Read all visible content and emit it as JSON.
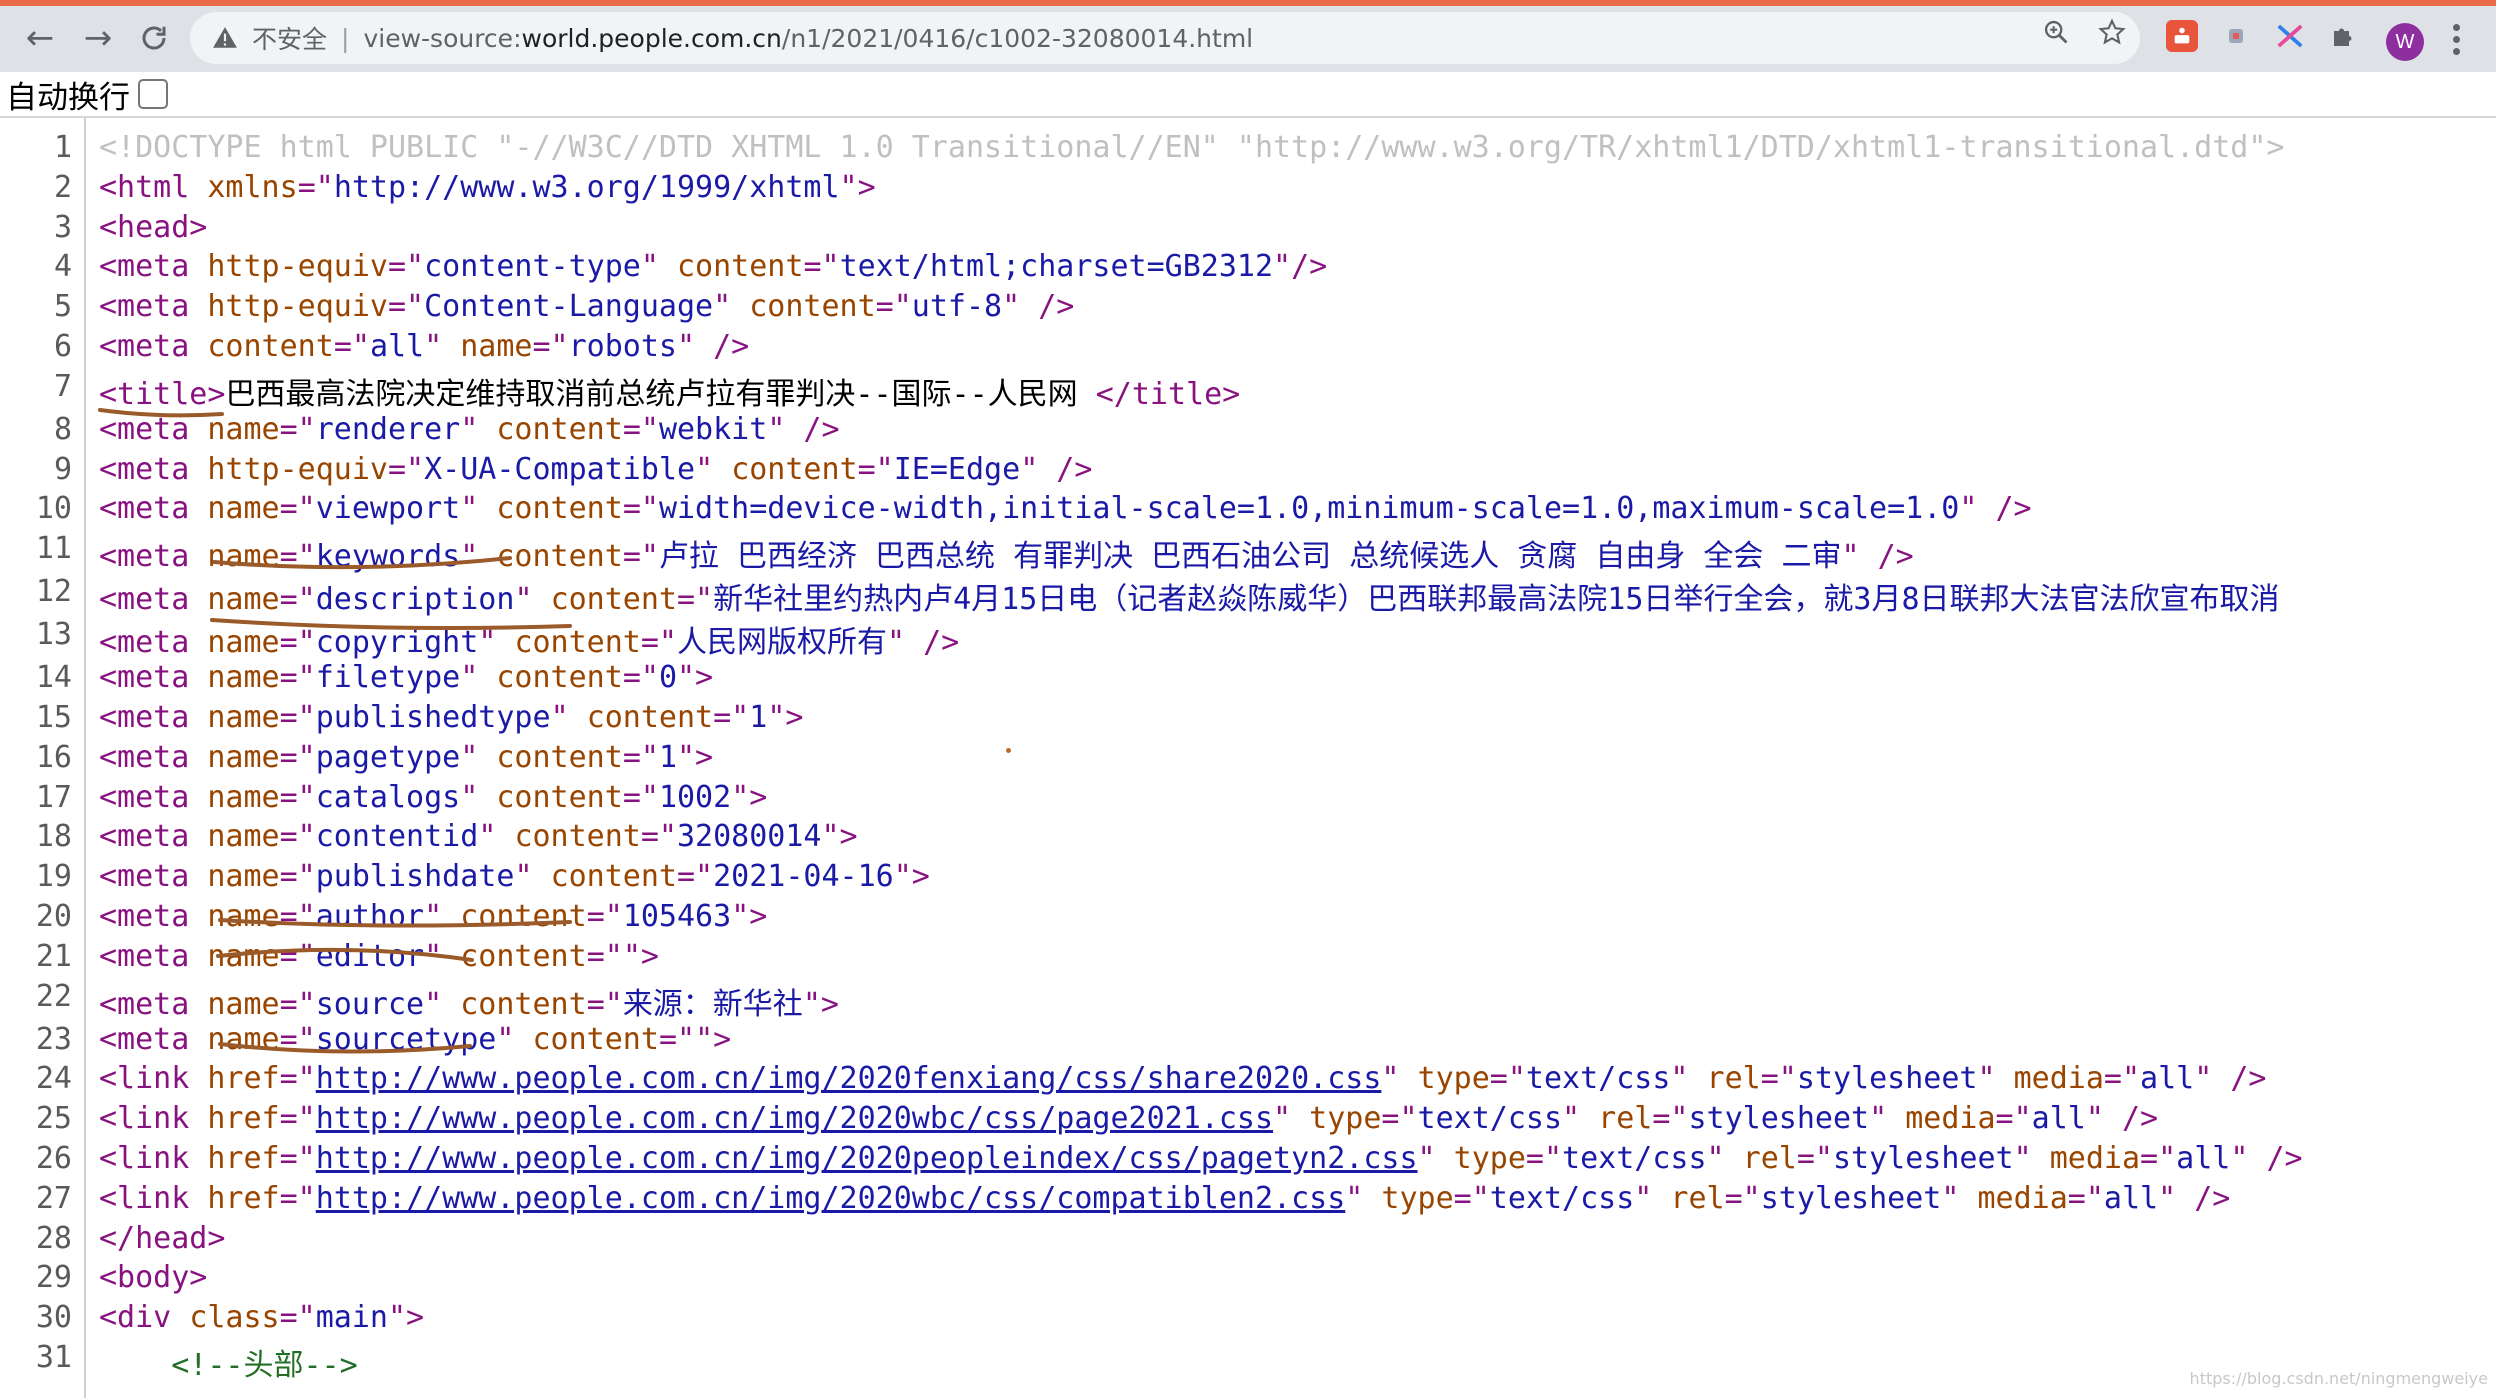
{
  "browser": {
    "security_label": "不安全",
    "url_prefix": "view-source:",
    "url_host": "world.people.com.cn",
    "url_path": "/n1/2021/0416/c1002-32080014.html",
    "avatar_letter": "W",
    "icons": [
      "back-icon",
      "forward-icon",
      "reload-icon",
      "warning-icon",
      "zoom-icon",
      "star-icon",
      "extension-icon",
      "puzzle-icon",
      "menu-icon"
    ]
  },
  "wrap_toggle": {
    "label": "自动换行",
    "checked": false
  },
  "source": {
    "lines": [
      {
        "n": "1",
        "tokens": [
          [
            "doc",
            "<!DOCTYPE html PUBLIC \"-//W3C//DTD XHTML 1.0 Transitional//EN\" \"http://www.w3.org/TR/xhtml1/DTD/xhtml1-transitional.dtd\">"
          ]
        ]
      },
      {
        "n": "2",
        "tokens": [
          [
            "tag",
            "<html "
          ],
          [
            "attr",
            "xmlns"
          ],
          [
            "tag",
            "=\""
          ],
          [
            "val",
            "http://www.w3.org/1999/xhtml"
          ],
          [
            "tag",
            "\">"
          ]
        ]
      },
      {
        "n": "3",
        "tokens": [
          [
            "tag",
            "<head>"
          ]
        ]
      },
      {
        "n": "4",
        "tokens": [
          [
            "tag",
            "<meta "
          ],
          [
            "attr",
            "http-equiv"
          ],
          [
            "tag",
            "=\""
          ],
          [
            "val",
            "content-type"
          ],
          [
            "tag",
            "\" "
          ],
          [
            "attr",
            "content"
          ],
          [
            "tag",
            "=\""
          ],
          [
            "val",
            "text/html;charset=GB2312"
          ],
          [
            "tag",
            "\"/>"
          ]
        ]
      },
      {
        "n": "5",
        "tokens": [
          [
            "tag",
            "<meta "
          ],
          [
            "attr",
            "http-equiv"
          ],
          [
            "tag",
            "=\""
          ],
          [
            "val",
            "Content-Language"
          ],
          [
            "tag",
            "\" "
          ],
          [
            "attr",
            "content"
          ],
          [
            "tag",
            "=\""
          ],
          [
            "val",
            "utf-8"
          ],
          [
            "tag",
            "\" />"
          ]
        ]
      },
      {
        "n": "6",
        "tokens": [
          [
            "tag",
            "<meta "
          ],
          [
            "attr",
            "content"
          ],
          [
            "tag",
            "=\""
          ],
          [
            "val",
            "all"
          ],
          [
            "tag",
            "\" "
          ],
          [
            "attr",
            "name"
          ],
          [
            "tag",
            "=\""
          ],
          [
            "val",
            "robots"
          ],
          [
            "tag",
            "\" />"
          ]
        ]
      },
      {
        "n": "7",
        "tokens": [
          [
            "tag",
            "<title>"
          ],
          [
            "text",
            "巴西最高法院决定维持取消前总统卢拉有罪判决--国际--人民网 "
          ],
          [
            "tag",
            "</title>"
          ]
        ]
      },
      {
        "n": "8",
        "tokens": [
          [
            "tag",
            "<meta "
          ],
          [
            "attr",
            "name"
          ],
          [
            "tag",
            "=\""
          ],
          [
            "val",
            "renderer"
          ],
          [
            "tag",
            "\" "
          ],
          [
            "attr",
            "content"
          ],
          [
            "tag",
            "=\""
          ],
          [
            "val",
            "webkit"
          ],
          [
            "tag",
            "\" />"
          ]
        ]
      },
      {
        "n": "9",
        "tokens": [
          [
            "tag",
            "<meta "
          ],
          [
            "attr",
            "http-equiv"
          ],
          [
            "tag",
            "=\""
          ],
          [
            "val",
            "X-UA-Compatible"
          ],
          [
            "tag",
            "\" "
          ],
          [
            "attr",
            "content"
          ],
          [
            "tag",
            "=\""
          ],
          [
            "val",
            "IE=Edge"
          ],
          [
            "tag",
            "\" />"
          ]
        ]
      },
      {
        "n": "10",
        "tokens": [
          [
            "tag",
            "<meta "
          ],
          [
            "attr",
            "name"
          ],
          [
            "tag",
            "=\""
          ],
          [
            "val",
            "viewport"
          ],
          [
            "tag",
            "\" "
          ],
          [
            "attr",
            "content"
          ],
          [
            "tag",
            "=\""
          ],
          [
            "val",
            "width=device-width,initial-scale=1.0,minimum-scale=1.0,maximum-scale=1.0"
          ],
          [
            "tag",
            "\" />"
          ]
        ]
      },
      {
        "n": "11",
        "tokens": [
          [
            "tag",
            "<meta "
          ],
          [
            "attr",
            "name"
          ],
          [
            "tag",
            "=\""
          ],
          [
            "val",
            "keywords"
          ],
          [
            "tag",
            "\" "
          ],
          [
            "attr",
            "content"
          ],
          [
            "tag",
            "=\""
          ],
          [
            "val",
            "卢拉 巴西经济 巴西总统 有罪判决 巴西石油公司 总统候选人 贪腐 自由身 全会 二审"
          ],
          [
            "tag",
            "\" />"
          ]
        ]
      },
      {
        "n": "12",
        "tokens": [
          [
            "tag",
            "<meta "
          ],
          [
            "attr",
            "name"
          ],
          [
            "tag",
            "=\""
          ],
          [
            "val",
            "description"
          ],
          [
            "tag",
            "\" "
          ],
          [
            "attr",
            "content"
          ],
          [
            "tag",
            "=\""
          ],
          [
            "val",
            "新华社里约热内卢4月15日电（记者赵焱陈威华）巴西联邦最高法院15日举行全会，就3月8日联邦大法官法欣宣布取消"
          ]
        ]
      },
      {
        "n": "13",
        "tokens": [
          [
            "tag",
            "<meta "
          ],
          [
            "attr",
            "name"
          ],
          [
            "tag",
            "=\""
          ],
          [
            "val",
            "copyright"
          ],
          [
            "tag",
            "\" "
          ],
          [
            "attr",
            "content"
          ],
          [
            "tag",
            "=\""
          ],
          [
            "val",
            "人民网版权所有"
          ],
          [
            "tag",
            "\" />"
          ]
        ]
      },
      {
        "n": "14",
        "tokens": [
          [
            "tag",
            "<meta "
          ],
          [
            "attr",
            "name"
          ],
          [
            "tag",
            "=\""
          ],
          [
            "val",
            "filetype"
          ],
          [
            "tag",
            "\" "
          ],
          [
            "attr",
            "content"
          ],
          [
            "tag",
            "=\""
          ],
          [
            "val",
            "0"
          ],
          [
            "tag",
            "\">"
          ]
        ]
      },
      {
        "n": "15",
        "tokens": [
          [
            "tag",
            "<meta "
          ],
          [
            "attr",
            "name"
          ],
          [
            "tag",
            "=\""
          ],
          [
            "val",
            "publishedtype"
          ],
          [
            "tag",
            "\" "
          ],
          [
            "attr",
            "content"
          ],
          [
            "tag",
            "=\""
          ],
          [
            "val",
            "1"
          ],
          [
            "tag",
            "\">"
          ]
        ]
      },
      {
        "n": "16",
        "tokens": [
          [
            "tag",
            "<meta "
          ],
          [
            "attr",
            "name"
          ],
          [
            "tag",
            "=\""
          ],
          [
            "val",
            "pagetype"
          ],
          [
            "tag",
            "\" "
          ],
          [
            "attr",
            "content"
          ],
          [
            "tag",
            "=\""
          ],
          [
            "val",
            "1"
          ],
          [
            "tag",
            "\">"
          ]
        ]
      },
      {
        "n": "17",
        "tokens": [
          [
            "tag",
            "<meta "
          ],
          [
            "attr",
            "name"
          ],
          [
            "tag",
            "=\""
          ],
          [
            "val",
            "catalogs"
          ],
          [
            "tag",
            "\" "
          ],
          [
            "attr",
            "content"
          ],
          [
            "tag",
            "=\""
          ],
          [
            "val",
            "1002"
          ],
          [
            "tag",
            "\">"
          ]
        ]
      },
      {
        "n": "18",
        "tokens": [
          [
            "tag",
            "<meta "
          ],
          [
            "attr",
            "name"
          ],
          [
            "tag",
            "=\""
          ],
          [
            "val",
            "contentid"
          ],
          [
            "tag",
            "\" "
          ],
          [
            "attr",
            "content"
          ],
          [
            "tag",
            "=\""
          ],
          [
            "val",
            "32080014"
          ],
          [
            "tag",
            "\">"
          ]
        ]
      },
      {
        "n": "19",
        "tokens": [
          [
            "tag",
            "<meta "
          ],
          [
            "attr",
            "name"
          ],
          [
            "tag",
            "=\""
          ],
          [
            "val",
            "publishdate"
          ],
          [
            "tag",
            "\" "
          ],
          [
            "attr",
            "content"
          ],
          [
            "tag",
            "=\""
          ],
          [
            "val",
            "2021-04-16"
          ],
          [
            "tag",
            "\">"
          ]
        ]
      },
      {
        "n": "20",
        "tokens": [
          [
            "tag",
            "<meta "
          ],
          [
            "attr",
            "name"
          ],
          [
            "tag",
            "=\""
          ],
          [
            "val",
            "author"
          ],
          [
            "tag",
            "\" "
          ],
          [
            "attr",
            "content"
          ],
          [
            "tag",
            "=\""
          ],
          [
            "val",
            "105463"
          ],
          [
            "tag",
            "\">"
          ]
        ]
      },
      {
        "n": "21",
        "tokens": [
          [
            "tag",
            "<meta "
          ],
          [
            "attr",
            "name"
          ],
          [
            "tag",
            "=\""
          ],
          [
            "val",
            "editor"
          ],
          [
            "tag",
            "\" "
          ],
          [
            "attr",
            "content"
          ],
          [
            "tag",
            "=\""
          ],
          [
            "val",
            ""
          ],
          [
            "tag",
            "\">"
          ]
        ]
      },
      {
        "n": "22",
        "tokens": [
          [
            "tag",
            "<meta "
          ],
          [
            "attr",
            "name"
          ],
          [
            "tag",
            "=\""
          ],
          [
            "val",
            "source"
          ],
          [
            "tag",
            "\" "
          ],
          [
            "attr",
            "content"
          ],
          [
            "tag",
            "=\""
          ],
          [
            "val",
            "来源：新华社"
          ],
          [
            "tag",
            "\">"
          ]
        ]
      },
      {
        "n": "23",
        "tokens": [
          [
            "tag",
            "<meta "
          ],
          [
            "attr",
            "name"
          ],
          [
            "tag",
            "=\""
          ],
          [
            "val",
            "sourcetype"
          ],
          [
            "tag",
            "\" "
          ],
          [
            "attr",
            "content"
          ],
          [
            "tag",
            "=\""
          ],
          [
            "val",
            ""
          ],
          [
            "tag",
            "\">"
          ]
        ]
      },
      {
        "n": "24",
        "tokens": [
          [
            "tag",
            "<link "
          ],
          [
            "attr",
            "href"
          ],
          [
            "tag",
            "=\""
          ],
          [
            "link",
            "http://www.people.com.cn/img/2020fenxiang/css/share2020.css"
          ],
          [
            "tag",
            "\" "
          ],
          [
            "attr",
            "type"
          ],
          [
            "tag",
            "=\""
          ],
          [
            "val",
            "text/css"
          ],
          [
            "tag",
            "\" "
          ],
          [
            "attr",
            "rel"
          ],
          [
            "tag",
            "=\""
          ],
          [
            "val",
            "stylesheet"
          ],
          [
            "tag",
            "\" "
          ],
          [
            "attr",
            "media"
          ],
          [
            "tag",
            "=\""
          ],
          [
            "val",
            "all"
          ],
          [
            "tag",
            "\" />"
          ]
        ]
      },
      {
        "n": "25",
        "tokens": [
          [
            "tag",
            "<link "
          ],
          [
            "attr",
            "href"
          ],
          [
            "tag",
            "=\""
          ],
          [
            "link",
            "http://www.people.com.cn/img/2020wbc/css/page2021.css"
          ],
          [
            "tag",
            "\" "
          ],
          [
            "attr",
            "type"
          ],
          [
            "tag",
            "=\""
          ],
          [
            "val",
            "text/css"
          ],
          [
            "tag",
            "\" "
          ],
          [
            "attr",
            "rel"
          ],
          [
            "tag",
            "=\""
          ],
          [
            "val",
            "stylesheet"
          ],
          [
            "tag",
            "\" "
          ],
          [
            "attr",
            "media"
          ],
          [
            "tag",
            "=\""
          ],
          [
            "val",
            "all"
          ],
          [
            "tag",
            "\" />"
          ]
        ]
      },
      {
        "n": "26",
        "tokens": [
          [
            "tag",
            "<link "
          ],
          [
            "attr",
            "href"
          ],
          [
            "tag",
            "=\""
          ],
          [
            "link",
            "http://www.people.com.cn/img/2020peopleindex/css/pagetyn2.css"
          ],
          [
            "tag",
            "\" "
          ],
          [
            "attr",
            "type"
          ],
          [
            "tag",
            "=\""
          ],
          [
            "val",
            "text/css"
          ],
          [
            "tag",
            "\" "
          ],
          [
            "attr",
            "rel"
          ],
          [
            "tag",
            "=\""
          ],
          [
            "val",
            "stylesheet"
          ],
          [
            "tag",
            "\" "
          ],
          [
            "attr",
            "media"
          ],
          [
            "tag",
            "=\""
          ],
          [
            "val",
            "all"
          ],
          [
            "tag",
            "\" />"
          ]
        ]
      },
      {
        "n": "27",
        "tokens": [
          [
            "tag",
            "<link "
          ],
          [
            "attr",
            "href"
          ],
          [
            "tag",
            "=\""
          ],
          [
            "link",
            "http://www.people.com.cn/img/2020wbc/css/compatiblen2.css"
          ],
          [
            "tag",
            "\" "
          ],
          [
            "attr",
            "type"
          ],
          [
            "tag",
            "=\""
          ],
          [
            "val",
            "text/css"
          ],
          [
            "tag",
            "\" "
          ],
          [
            "attr",
            "rel"
          ],
          [
            "tag",
            "=\""
          ],
          [
            "val",
            "stylesheet"
          ],
          [
            "tag",
            "\" "
          ],
          [
            "attr",
            "media"
          ],
          [
            "tag",
            "=\""
          ],
          [
            "val",
            "all"
          ],
          [
            "tag",
            "\" />"
          ]
        ]
      },
      {
        "n": "28",
        "tokens": [
          [
            "tag",
            "</head>"
          ]
        ]
      },
      {
        "n": "29",
        "tokens": [
          [
            "tag",
            "<body>"
          ]
        ]
      },
      {
        "n": "30",
        "tokens": [
          [
            "tag",
            "<div "
          ],
          [
            "attr",
            "class"
          ],
          [
            "tag",
            "=\""
          ],
          [
            "val",
            "main"
          ],
          [
            "tag",
            "\">"
          ]
        ]
      },
      {
        "n": "31",
        "tokens": [
          [
            "text",
            "    "
          ],
          [
            "cmt",
            "<!--头部-->"
          ]
        ]
      }
    ]
  },
  "annotation_color": "#9a5a2a",
  "watermark": "https://blog.csdn.net/ningmengweiye"
}
